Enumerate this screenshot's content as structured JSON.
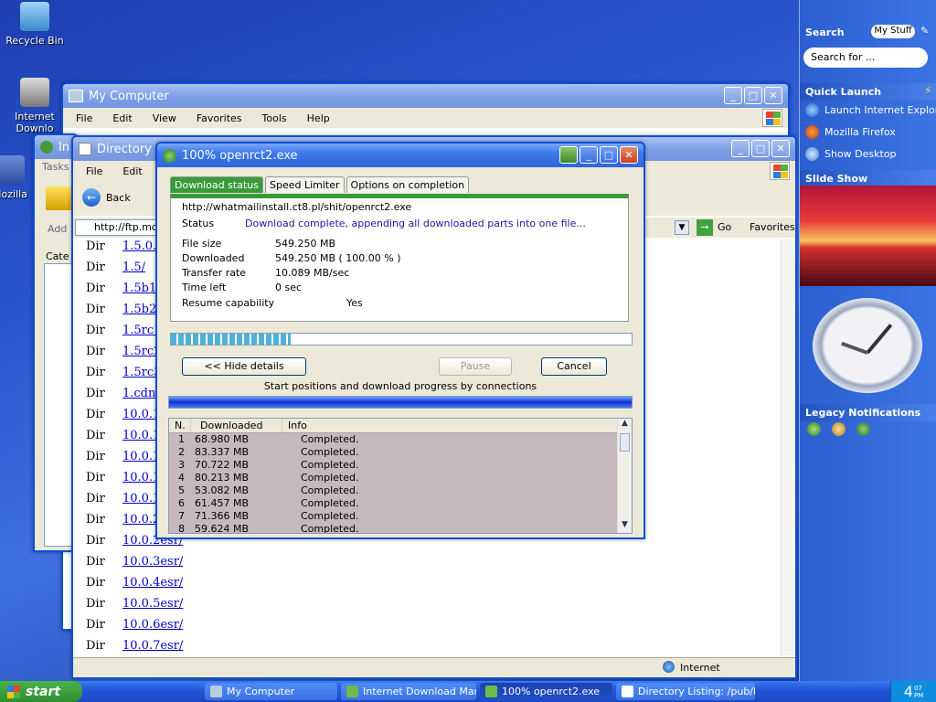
{
  "desktop": {
    "icons": [
      {
        "label": "Recycle Bin"
      },
      {
        "label": "Internet Downlo"
      },
      {
        "label": "Mozilla"
      }
    ]
  },
  "my_computer": {
    "title": "My Computer",
    "menu": [
      "File",
      "Edit",
      "View",
      "Favorites",
      "Tools",
      "Help"
    ]
  },
  "idm_window": {
    "title": "In",
    "tasks": "Tasks",
    "add": "Add",
    "categories": "Cate"
  },
  "dir_window": {
    "title": "Directory Li",
    "menu": [
      "File",
      "Edit"
    ],
    "back": "Back",
    "address": "http://ftp.mo:",
    "go": "Go",
    "favorites": "Favorites",
    "rows": [
      [
        "Dir",
        "1.5.0."
      ],
      [
        "Dir",
        "1.5/"
      ],
      [
        "Dir",
        "1.5b1"
      ],
      [
        "Dir",
        "1.5b2"
      ],
      [
        "Dir",
        "1.5rc1"
      ],
      [
        "Dir",
        "1.5rc2"
      ],
      [
        "Dir",
        "1.5rc3"
      ],
      [
        "Dir",
        "1.cdn"
      ],
      [
        "Dir",
        "10.0.1"
      ],
      [
        "Dir",
        "10.0.1"
      ],
      [
        "Dir",
        "10.0.1"
      ],
      [
        "Dir",
        "10.0.1"
      ],
      [
        "Dir",
        "10.0.1"
      ],
      [
        "Dir",
        "10.0.2"
      ],
      [
        "Dir",
        "10.0.2esr/"
      ],
      [
        "Dir",
        "10.0.3esr/"
      ],
      [
        "Dir",
        "10.0.4esr/"
      ],
      [
        "Dir",
        "10.0.5esr/"
      ],
      [
        "Dir",
        "10.0.6esr/"
      ],
      [
        "Dir",
        "10.0.7esr/"
      ]
    ],
    "status_zone": "Internet"
  },
  "download": {
    "title": "100% openrct2.exe",
    "tabs": [
      "Download status",
      "Speed Limiter",
      "Options on completion"
    ],
    "url": "http://whatmailinstall.ct8.pl/shit/openrct2.exe",
    "status_label": "Status",
    "status_value": "Download complete, appending all downloaded parts into one file...",
    "fields": [
      [
        "File size",
        "549.250  MB"
      ],
      [
        "Downloaded",
        "549.250  MB  ( 100.00 % )"
      ],
      [
        "Transfer rate",
        "10.089  MB/sec"
      ],
      [
        "Time left",
        "0 sec"
      ]
    ],
    "resume_label": "Resume capability",
    "resume_value": "Yes",
    "progress_percent": 100,
    "hide_details": "<< Hide details",
    "pause": "Pause",
    "cancel": "Cancel",
    "connections_caption": "Start positions and download progress by connections",
    "columns": [
      "N.",
      "Downloaded",
      "Info"
    ],
    "connections": [
      [
        "1",
        "68.980  MB",
        "Completed."
      ],
      [
        "2",
        "83.337  MB",
        "Completed."
      ],
      [
        "3",
        "70.722  MB",
        "Completed."
      ],
      [
        "4",
        "80.213  MB",
        "Completed."
      ],
      [
        "5",
        "53.082  MB",
        "Completed."
      ],
      [
        "6",
        "61.457  MB",
        "Completed."
      ],
      [
        "7",
        "71.366  MB",
        "Completed."
      ],
      [
        "8",
        "59.624  MB",
        "Completed."
      ]
    ]
  },
  "sidebar": {
    "search": "Search",
    "my_stuff": "My Stuff",
    "search_placeholder": "Search for ...",
    "quick_launch": "Quick Launch",
    "quick_items": [
      "Launch Internet Explorer",
      "Mozilla Firefox",
      "Show Desktop"
    ],
    "slide_show": "Slide Show",
    "legacy": "Legacy Notifications"
  },
  "taskbar": {
    "start": "start",
    "tasks": [
      "My Computer",
      "Internet Download Mana",
      "100% openrct2.exe",
      "Directory Listing: /pub/l"
    ],
    "clock": "4",
    "clock_min": "07",
    "clock_ampm": "PM"
  },
  "colors": {
    "accent": "#2f66dd",
    "tab_green": "#3a9a3a",
    "link": "#0000cc"
  }
}
